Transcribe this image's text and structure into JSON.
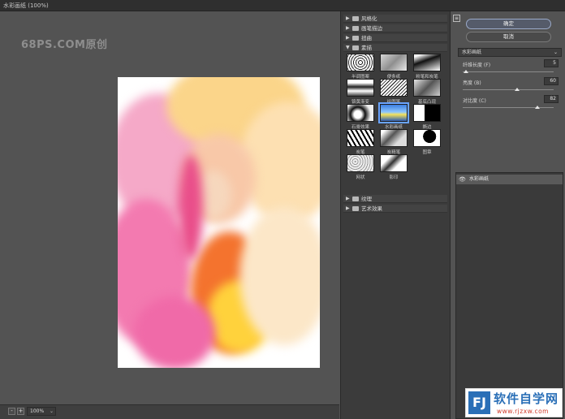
{
  "window": {
    "title": "水彩画纸 (100%)"
  },
  "watermark": "68PS.COM原创",
  "status": {
    "zoom_out": "-",
    "zoom_in": "+",
    "zoom_value": "100%",
    "zoom_caret": "⌄"
  },
  "gallery": {
    "categories": [
      {
        "label": "风格化",
        "arrow": "▶"
      },
      {
        "label": "画笔描边",
        "arrow": "▶"
      },
      {
        "label": "扭曲",
        "arrow": "▶"
      },
      {
        "label": "素描",
        "arrow": "▼"
      },
      {
        "label": "纹理",
        "arrow": "▶"
      },
      {
        "label": "艺术效果",
        "arrow": "▶"
      }
    ],
    "thumbs": [
      "半调图案",
      "便条纸",
      "粉笔和炭笔",
      "铬黄渐变",
      "绘图笔",
      "基底凸现",
      "石膏效果",
      "水彩画纸",
      "撕边",
      "炭笔",
      "炭精笔",
      "图章",
      "网状",
      "影印"
    ]
  },
  "settings": {
    "collapse_icon": "≡",
    "ok_label": "确定",
    "cancel_label": "取消",
    "filter_select": "水彩画纸",
    "filter_caret": "⌄",
    "params": [
      {
        "label": "纤维长度 (F)",
        "value": "5",
        "level": 0.04
      },
      {
        "label": "亮度 (B)",
        "value": "60",
        "level": 0.6
      },
      {
        "label": "对比度 (C)",
        "value": "82",
        "level": 0.82
      }
    ],
    "layer": {
      "eye": "👁",
      "name": "水彩画纸"
    }
  },
  "logo": {
    "mark": "FJ",
    "brand": "软件自学网",
    "url": "www.rjzxw.com"
  }
}
